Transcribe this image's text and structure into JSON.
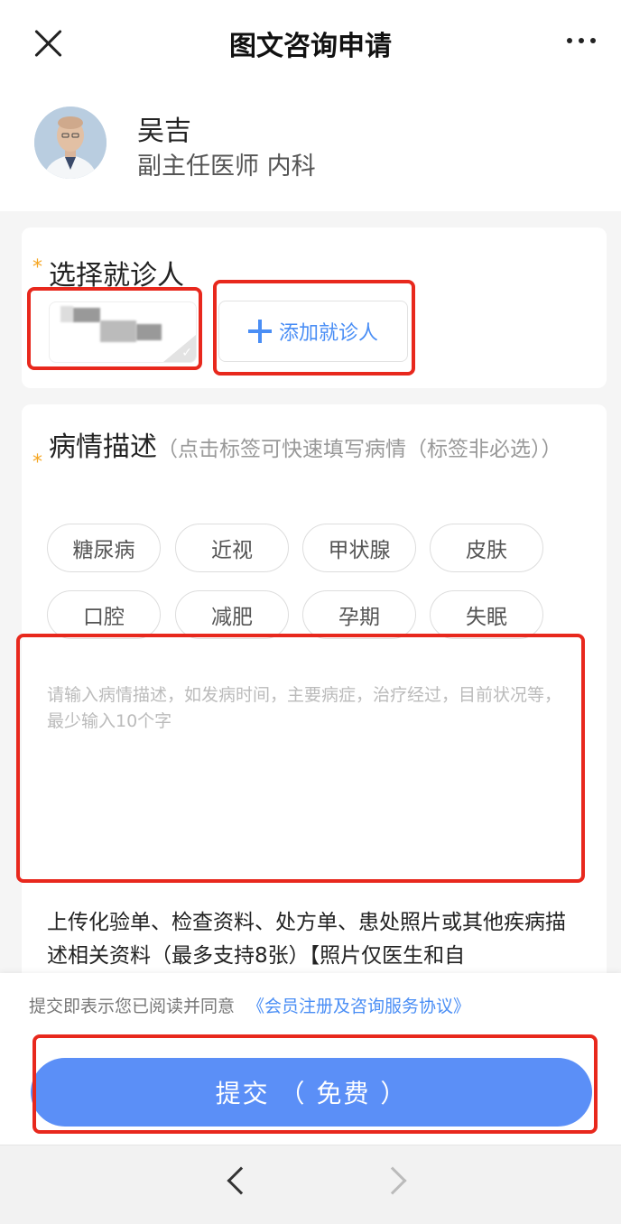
{
  "header": {
    "title": "图文咨询申请"
  },
  "doctor": {
    "name": "吴吉",
    "title": "副主任医师 内科"
  },
  "patient_section": {
    "required_mark": "*",
    "label": "选择就诊人",
    "add_label": "添加就诊人"
  },
  "condition_section": {
    "required_mark": "*",
    "label": "病情描述",
    "hint": "（点击标签可快速填写病情（标签非必选））",
    "tags": [
      "糖尿病",
      "近视",
      "甲状腺",
      "皮肤",
      "口腔",
      "减肥",
      "孕期",
      "失眠"
    ],
    "placeholder": "请输入病情描述，如发病时间，主要病症，治疗经过，目前状况等，最少输入10个字"
  },
  "upload": {
    "text": "上传化验单、检查资料、处方单、患处照片或其他疾病描述相关资料（最多支持8张）【照片仅医生和自"
  },
  "footer": {
    "agree_text": "提交即表示您已阅读并同意",
    "agree_link": "《会员注册及咨询服务协议》",
    "submit_label": "提交 （ 免费 ）"
  },
  "colors": {
    "accent": "#5b8ff7",
    "link": "#4a8ef5",
    "highlight": "#e8281d",
    "required": "#f5a623"
  }
}
